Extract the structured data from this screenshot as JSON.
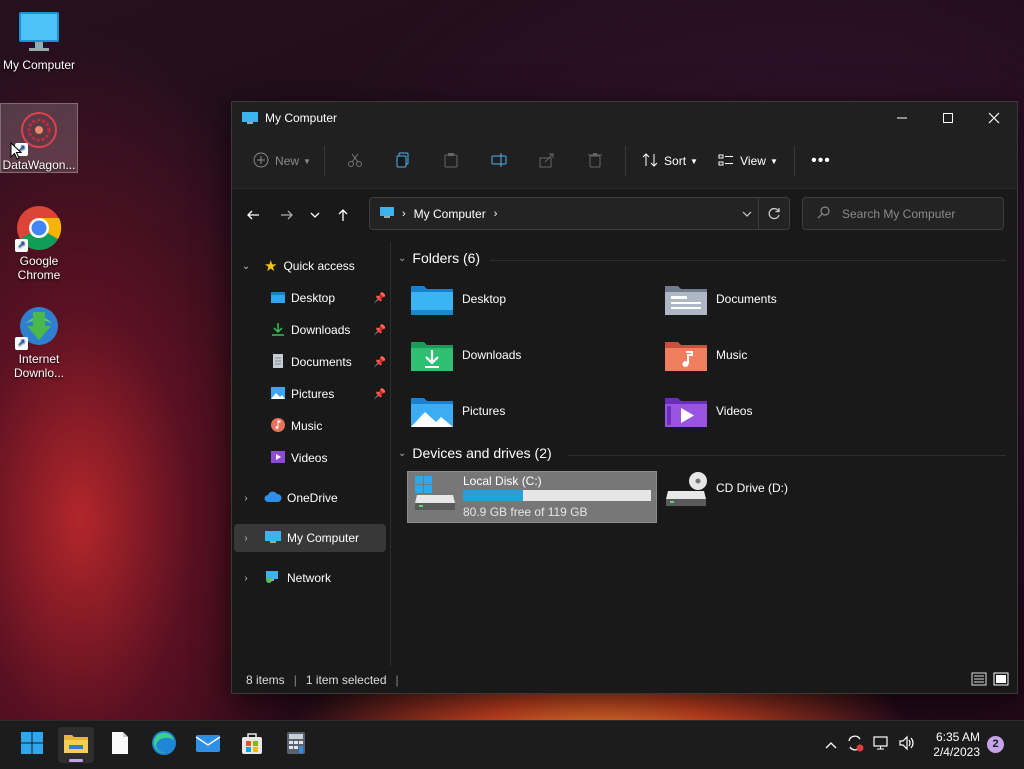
{
  "desktop": {
    "icons": [
      {
        "label": "My Computer"
      },
      {
        "label": "DataWagon..."
      },
      {
        "label": "Google Chrome"
      },
      {
        "label": "Internet Downlo..."
      }
    ]
  },
  "window": {
    "title": "My Computer",
    "toolbar": {
      "new_label": "New",
      "sort_label": "Sort",
      "view_label": "View"
    },
    "address": {
      "location": "My Computer"
    },
    "search": {
      "placeholder": "Search My Computer"
    },
    "sidebar": {
      "quick_access": "Quick access",
      "items": [
        {
          "label": "Desktop",
          "pinned": true
        },
        {
          "label": "Downloads",
          "pinned": true
        },
        {
          "label": "Documents",
          "pinned": true
        },
        {
          "label": "Pictures",
          "pinned": true
        },
        {
          "label": "Music",
          "pinned": false
        },
        {
          "label": "Videos",
          "pinned": false
        }
      ],
      "onedrive": "OneDrive",
      "my_computer": "My Computer",
      "network": "Network"
    },
    "folders_header": "Folders (6)",
    "folders": [
      {
        "label": "Desktop"
      },
      {
        "label": "Documents"
      },
      {
        "label": "Downloads"
      },
      {
        "label": "Music"
      },
      {
        "label": "Pictures"
      },
      {
        "label": "Videos"
      }
    ],
    "drives_header": "Devices and drives (2)",
    "drives": [
      {
        "label": "Local Disk (C:)",
        "free_text": "80.9 GB free of 119 GB",
        "used_fraction": 0.32
      },
      {
        "label": "CD Drive (D:)"
      }
    ],
    "status": {
      "items": "8 items",
      "selected": "1 item selected"
    }
  },
  "taskbar": {
    "time": "6:35 AM",
    "date": "2/4/2023",
    "notification_count": "2"
  },
  "colors": {
    "accent": "#26a0da",
    "window_bg": "#191919",
    "selection": "#383838"
  }
}
